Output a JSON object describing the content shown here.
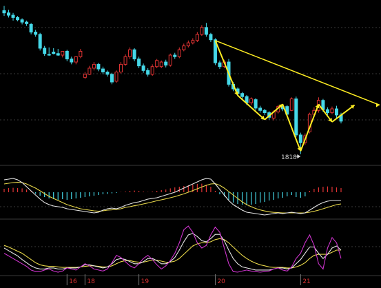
{
  "chart_data": {
    "type": "candlestick",
    "x_tick_labels": [
      "16",
      "18",
      "19",
      "20",
      "21"
    ],
    "annotation_low": {
      "label": "1818",
      "value": 1818
    },
    "colors": {
      "up": "#e23434",
      "down": "#45d8e8",
      "pattern": "#ffee22",
      "macd_dif": "#e6e6e6",
      "macd_dea": "#e8d84a",
      "osc_fast": "#cc33cc",
      "osc_mid": "#e6e6e6",
      "osc_slow": "#e8d84a",
      "grid": "#3a3a3a"
    },
    "price_range": [
      1800,
      2220
    ],
    "candles": [
      [
        2196,
        2208,
        2190,
        2182
      ],
      [
        2190,
        2198,
        2184,
        2178
      ],
      [
        2184,
        2190,
        2178,
        2170
      ],
      [
        2178,
        2182,
        2172,
        2168
      ],
      [
        2172,
        2176,
        2166,
        2160
      ],
      [
        2166,
        2170,
        2162,
        2156
      ],
      [
        2160,
        2164,
        2140,
        2134
      ],
      [
        2140,
        2146,
        2134,
        2128
      ],
      [
        2134,
        2138,
        2098,
        2092
      ],
      [
        2098,
        2104,
        2084,
        2078
      ],
      [
        2082,
        2100,
        2080,
        2078
      ],
      [
        2088,
        2098,
        2084,
        2082
      ],
      [
        2084,
        2096,
        2080,
        2078
      ],
      [
        2080,
        2090,
        2090,
        2074
      ],
      [
        2090,
        2094,
        2070,
        2064
      ],
      [
        2070,
        2076,
        2062,
        2056
      ],
      [
        2062,
        2078,
        2076,
        2056
      ],
      [
        2076,
        2096,
        2090,
        2072
      ],
      [
        2022,
        2036,
        2030,
        2018
      ],
      [
        2030,
        2052,
        2046,
        2028
      ],
      [
        2046,
        2062,
        2056,
        2040
      ],
      [
        2056,
        2060,
        2044,
        2038
      ],
      [
        2044,
        2050,
        2036,
        2030
      ],
      [
        2036,
        2040,
        2030,
        2024
      ],
      [
        2030,
        2034,
        2010,
        2004
      ],
      [
        2012,
        2040,
        2036,
        2008
      ],
      [
        2036,
        2062,
        2056,
        2032
      ],
      [
        2056,
        2082,
        2076,
        2052
      ],
      [
        2076,
        2100,
        2094,
        2070
      ],
      [
        2094,
        2098,
        2070,
        2064
      ],
      [
        2070,
        2076,
        2052,
        2046
      ],
      [
        2052,
        2058,
        2040,
        2034
      ],
      [
        2040,
        2046,
        2030,
        2024
      ],
      [
        2030,
        2056,
        2050,
        2026
      ],
      [
        2050,
        2070,
        2066,
        2046
      ],
      [
        2050,
        2066,
        2062,
        2046
      ],
      [
        2062,
        2068,
        2054,
        2048
      ],
      [
        2054,
        2084,
        2080,
        2050
      ],
      [
        2080,
        2086,
        2076,
        2070
      ],
      [
        2076,
        2100,
        2094,
        2072
      ],
      [
        2094,
        2110,
        2104,
        2090
      ],
      [
        2104,
        2118,
        2112,
        2100
      ],
      [
        2112,
        2124,
        2118,
        2108
      ],
      [
        2118,
        2140,
        2134,
        2114
      ],
      [
        2134,
        2158,
        2152,
        2130
      ],
      [
        2152,
        2164,
        2134,
        2128
      ],
      [
        2134,
        2138,
        2120,
        2114
      ],
      [
        2120,
        2124,
        2060,
        2054
      ],
      [
        2060,
        2066,
        2050,
        2044
      ],
      [
        2050,
        2068,
        2062,
        2046
      ],
      [
        2062,
        2070,
        2004,
        1998
      ],
      [
        2004,
        2010,
        1992,
        1986
      ],
      [
        1992,
        1996,
        1980,
        1974
      ],
      [
        1980,
        1984,
        1972,
        1966
      ],
      [
        1972,
        1976,
        1956,
        1950
      ],
      [
        1956,
        1970,
        1966,
        1950
      ],
      [
        1964,
        1968,
        1942,
        1936
      ],
      [
        1942,
        1948,
        1936,
        1930
      ],
      [
        1936,
        1940,
        1930,
        1924
      ],
      [
        1930,
        1934,
        1918,
        1912
      ],
      [
        1916,
        1936,
        1932,
        1910
      ],
      [
        1932,
        1950,
        1946,
        1928
      ],
      [
        1946,
        1952,
        1940,
        1934
      ],
      [
        1946,
        1950,
        1926,
        1920
      ],
      [
        1936,
        1970,
        1966,
        1934
      ],
      [
        1966,
        1972,
        1872,
        1866
      ],
      [
        1872,
        1878,
        1852,
        1822
      ],
      [
        1852,
        1876,
        1870,
        1846
      ],
      [
        1880,
        1930,
        1926,
        1876
      ],
      [
        1926,
        1944,
        1936,
        1920
      ],
      [
        1936,
        1970,
        1962,
        1930
      ],
      [
        1962,
        1966,
        1938,
        1932
      ],
      [
        1938,
        1944,
        1930,
        1924
      ],
      [
        1930,
        1946,
        1940,
        1926
      ],
      [
        1940,
        1948,
        1924,
        1916
      ],
      [
        1924,
        1930,
        1908,
        1902
      ]
    ],
    "macd": {
      "histogram": [
        0.25,
        0.3,
        0.32,
        0.3,
        0.28,
        0.2,
        0.05,
        -0.1,
        -0.25,
        -0.35,
        -0.45,
        -0.5,
        -0.55,
        -0.5,
        -0.55,
        -0.5,
        -0.45,
        -0.4,
        -0.35,
        -0.3,
        -0.25,
        -0.2,
        -0.15,
        -0.12,
        -0.08,
        -0.05,
        0.02,
        0.05,
        0.1,
        0.12,
        0.1,
        0.05,
        0.02,
        0.05,
        0.1,
        0.15,
        0.2,
        0.28,
        0.35,
        0.4,
        0.45,
        0.5,
        0.55,
        0.6,
        0.62,
        0.55,
        0.4,
        0.1,
        -0.15,
        -0.3,
        -0.55,
        -0.75,
        -0.85,
        -0.9,
        -0.95,
        -0.9,
        -0.85,
        -0.75,
        -0.7,
        -0.6,
        -0.55,
        -0.45,
        -0.4,
        -0.3,
        -0.2,
        -0.35,
        -0.4,
        -0.3,
        0.1,
        0.25,
        0.35,
        0.4,
        0.42,
        0.4,
        0.35,
        0.3
      ],
      "dif": [
        0.9,
        0.95,
        1,
        0.9,
        0.7,
        0.4,
        0.1,
        -0.2,
        -0.5,
        -0.75,
        -0.9,
        -1,
        -1.05,
        -1.1,
        -1.2,
        -1.25,
        -1.3,
        -1.35,
        -1.4,
        -1.45,
        -1.5,
        -1.45,
        -1.3,
        -1.2,
        -1.15,
        -1.2,
        -1.1,
        -0.95,
        -0.85,
        -0.75,
        -0.7,
        -0.6,
        -0.5,
        -0.45,
        -0.4,
        -0.3,
        -0.2,
        -0.1,
        0,
        0.15,
        0.3,
        0.45,
        0.6,
        0.75,
        0.9,
        1,
        0.95,
        0.6,
        0.2,
        -0.2,
        -0.6,
        -0.9,
        -1.1,
        -1.3,
        -1.45,
        -1.5,
        -1.55,
        -1.6,
        -1.65,
        -1.6,
        -1.55,
        -1.5,
        -1.55,
        -1.5,
        -1.45,
        -1.5,
        -1.55,
        -1.5,
        -1.3,
        -1.1,
        -0.9,
        -0.75,
        -0.65,
        -0.6,
        -0.6,
        -0.6
      ],
      "dea": [
        0.6,
        0.65,
        0.7,
        0.72,
        0.7,
        0.6,
        0.45,
        0.3,
        0.1,
        -0.1,
        -0.3,
        -0.45,
        -0.6,
        -0.75,
        -0.9,
        -1,
        -1.1,
        -1.2,
        -1.25,
        -1.3,
        -1.35,
        -1.38,
        -1.35,
        -1.3,
        -1.28,
        -1.25,
        -1.2,
        -1.1,
        -1.05,
        -0.98,
        -0.92,
        -0.85,
        -0.78,
        -0.7,
        -0.62,
        -0.55,
        -0.48,
        -0.4,
        -0.32,
        -0.22,
        -0.12,
        0,
        0.12,
        0.25,
        0.38,
        0.5,
        0.6,
        0.62,
        0.5,
        0.3,
        0.05,
        -0.2,
        -0.45,
        -0.7,
        -0.9,
        -1.05,
        -1.18,
        -1.28,
        -1.36,
        -1.42,
        -1.46,
        -1.48,
        -1.5,
        -1.5,
        -1.5,
        -1.5,
        -1.5,
        -1.5,
        -1.45,
        -1.38,
        -1.3,
        -1.2,
        -1.1,
        -1,
        -0.9,
        -0.85
      ]
    },
    "oscillator": {
      "fast": [
        40,
        35,
        30,
        25,
        20,
        15,
        8,
        5,
        5,
        8,
        10,
        6,
        4,
        6,
        12,
        10,
        8,
        14,
        20,
        16,
        10,
        8,
        6,
        10,
        22,
        36,
        32,
        24,
        16,
        12,
        20,
        30,
        36,
        28,
        18,
        10,
        16,
        26,
        40,
        60,
        85,
        92,
        80,
        60,
        50,
        55,
        75,
        90,
        80,
        50,
        20,
        5,
        4,
        6,
        8,
        6,
        5,
        4,
        5,
        6,
        10,
        12,
        8,
        6,
        14,
        30,
        40,
        60,
        75,
        55,
        20,
        10,
        50,
        70,
        60,
        30
      ],
      "mid": [
        50,
        45,
        40,
        35,
        28,
        22,
        16,
        12,
        10,
        10,
        12,
        12,
        10,
        10,
        12,
        12,
        12,
        14,
        18,
        18,
        16,
        14,
        12,
        14,
        20,
        28,
        30,
        28,
        24,
        20,
        20,
        24,
        30,
        30,
        26,
        20,
        20,
        24,
        32,
        46,
        62,
        75,
        78,
        72,
        64,
        62,
        68,
        76,
        76,
        64,
        46,
        30,
        20,
        14,
        12,
        10,
        8,
        8,
        8,
        8,
        10,
        12,
        12,
        10,
        12,
        20,
        28,
        40,
        52,
        52,
        40,
        30,
        38,
        50,
        54,
        46
      ],
      "slow": [
        55,
        52,
        48,
        44,
        40,
        34,
        28,
        22,
        18,
        16,
        15,
        15,
        14,
        13,
        13,
        13,
        13,
        14,
        15,
        16,
        16,
        15,
        14,
        14,
        16,
        20,
        24,
        26,
        26,
        24,
        23,
        23,
        25,
        27,
        27,
        25,
        23,
        23,
        25,
        30,
        38,
        46,
        54,
        58,
        60,
        60,
        62,
        66,
        68,
        66,
        60,
        52,
        44,
        36,
        30,
        25,
        21,
        18,
        16,
        14,
        13,
        13,
        13,
        12,
        12,
        14,
        17,
        22,
        30,
        36,
        38,
        38,
        38,
        42,
        46,
        46
      ]
    }
  }
}
